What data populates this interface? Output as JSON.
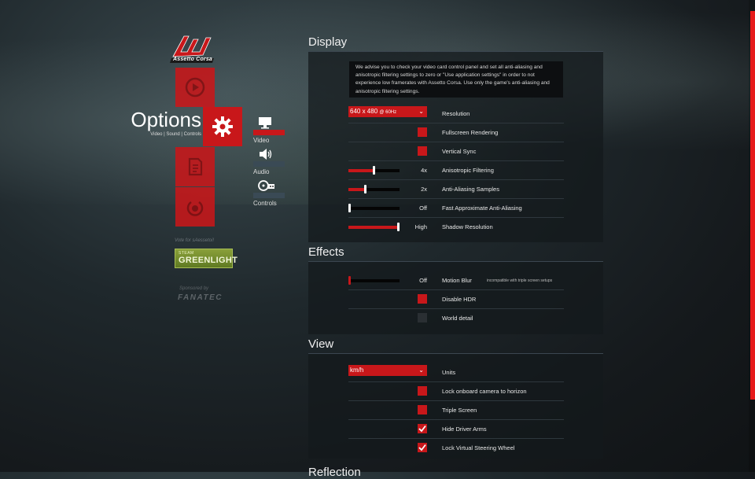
{
  "brand": {
    "logo_text": "Assetto Corsa",
    "accent": "#c8171a"
  },
  "menu": {
    "title": "Options",
    "subtitle": "Video | Sound | Controls",
    "tiles": [
      {
        "name": "drive",
        "icon": "play-circle-icon"
      },
      {
        "name": "options",
        "icon": "gear-icon"
      },
      {
        "name": "replays",
        "icon": "document-icon"
      },
      {
        "name": "quit",
        "icon": "power-icon"
      }
    ],
    "sub": [
      {
        "label": "Video",
        "icon": "monitor-icon",
        "active": true
      },
      {
        "label": "Audio",
        "icon": "speaker-icon",
        "active": false
      },
      {
        "label": "Controls",
        "icon": "steering-wheel-icon",
        "active": false
      }
    ],
    "vote_text": "Vote for sAessetoi!",
    "greenlight_steam": "STEAM",
    "greenlight_text": "GREENLIGHT",
    "sponsored_text": "Sponsored by",
    "sponsor_name": "FANATEC"
  },
  "display": {
    "title": "Display",
    "advice": "We advise you to check your video card control panel and set all anti-aliasing and anisotropic filtering settings to zero or \"Use application settings\" in order to not experience low framerates with Assetto Corsa. Use only the game's anti-aliasing and anisotropic filtering settings.",
    "resolution": {
      "label": "Resolution",
      "value": "640 x 480",
      "hz": "@ 60Hz"
    },
    "fullscreen": {
      "label": "Fullscreen Rendering",
      "checked": false
    },
    "vsync": {
      "label": "Vertical Sync",
      "checked": false
    },
    "anisotropic": {
      "label": "Anisotropic Filtering",
      "value": "4x",
      "level": 0.5
    },
    "antialiasing": {
      "label": "Anti-Aliasing Samples",
      "value": "2x",
      "level": 0.33
    },
    "fxaa": {
      "label": "Fast Approximate Anti-Aliasing",
      "value": "Off",
      "level": 0.0
    },
    "shadow": {
      "label": "Shadow Resolution",
      "value": "High",
      "level": 1.0
    }
  },
  "effects": {
    "title": "Effects",
    "motion_blur": {
      "label": "Motion Blur",
      "value": "Off",
      "level": 0.0,
      "note": "incompatible with triple screen setups"
    },
    "disable_hdr": {
      "label": "Disable HDR",
      "checked": false
    },
    "world_detail": {
      "label": "World detail",
      "checked": false
    }
  },
  "view": {
    "title": "View",
    "units": {
      "label": "Units",
      "value": "km/h"
    },
    "lock_camera": {
      "label": "Lock onboard camera to horizon",
      "checked": false
    },
    "triple_screen": {
      "label": "Triple Screen",
      "checked": false
    },
    "hide_arms": {
      "label": "Hide Driver Arms",
      "checked": true
    },
    "lock_wheel": {
      "label": "Lock Virtual Steering Wheel",
      "checked": true
    }
  },
  "next_section_title": "Reflection"
}
